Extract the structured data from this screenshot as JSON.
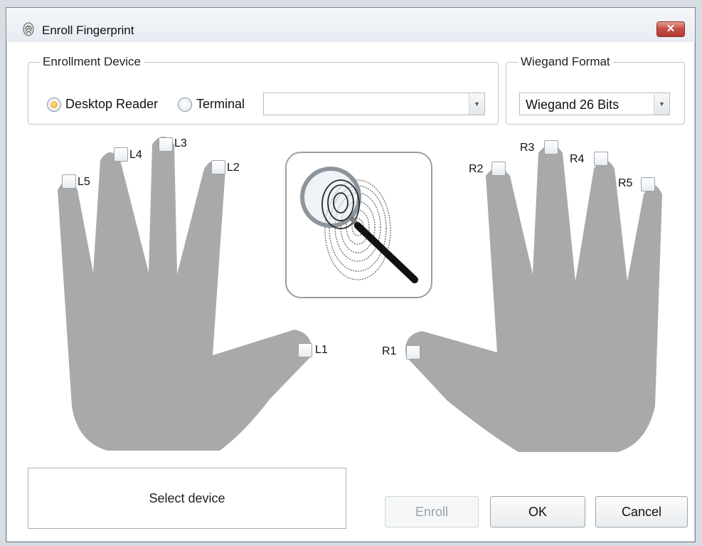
{
  "window": {
    "title": "Enroll Fingerprint",
    "close_label": "✕"
  },
  "enrollment_device": {
    "legend": "Enrollment Device",
    "options": [
      {
        "label": "Desktop Reader",
        "selected": true
      },
      {
        "label": "Terminal",
        "selected": false
      }
    ],
    "terminal_value": ""
  },
  "wiegand": {
    "legend": "Wiegand Format",
    "value": "Wiegand 26 Bits"
  },
  "fingers": {
    "L1": "L1",
    "L2": "L2",
    "L3": "L3",
    "L4": "L4",
    "L5": "L5",
    "R1": "R1",
    "R2": "R2",
    "R3": "R3",
    "R4": "R4",
    "R5": "R5"
  },
  "scanner": {
    "icon": "fingerprint-magnifier-icon"
  },
  "status": {
    "text": "Select device"
  },
  "buttons": {
    "enroll": "Enroll",
    "ok": "OK",
    "cancel": "Cancel",
    "enroll_enabled": false
  },
  "colors": {
    "hand": "#a9a9a9",
    "radio_selected": "#e8a31a",
    "close_button": "#c75046"
  }
}
